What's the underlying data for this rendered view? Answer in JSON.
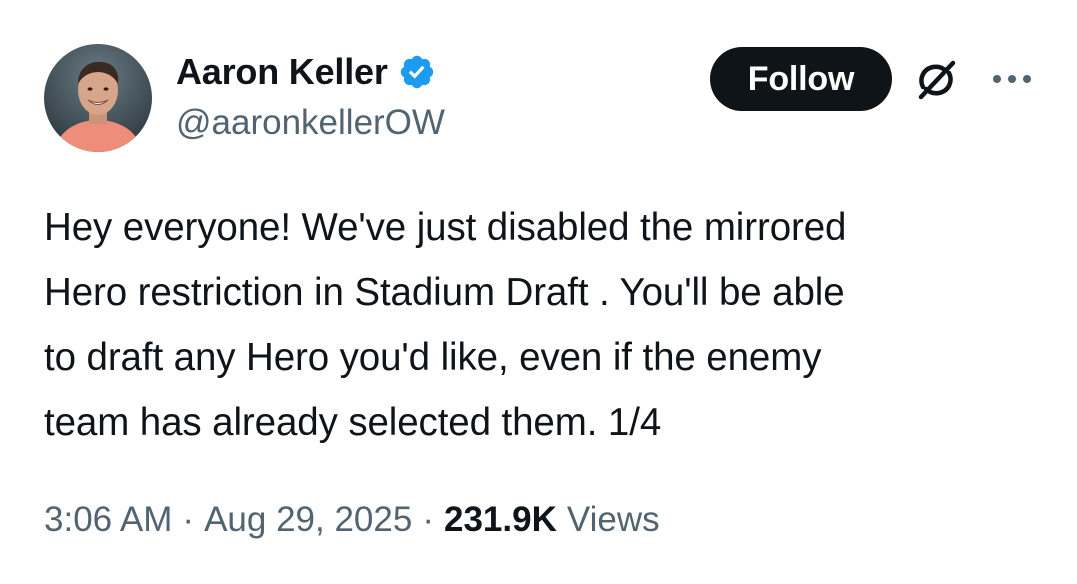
{
  "author": {
    "display_name": "Aaron Keller",
    "handle": "@aaronkellerOW",
    "verified": true,
    "verified_color": "#1d9bf0"
  },
  "actions": {
    "follow_label": "Follow",
    "grok_icon": "grok-icon",
    "more_icon": "more-options-icon"
  },
  "tweet": {
    "text_lines": [
      "Hey everyone! We've just disabled the mirrored",
      "Hero restriction in Stadium Draft . You'll be able",
      "to draft any Hero you'd like, even if the enemy",
      "team has already selected them. 1/4"
    ]
  },
  "meta": {
    "time": "3:06 AM",
    "separator": "·",
    "date": "Aug 29, 2025",
    "views_count": "231.9K",
    "views_label": "Views"
  },
  "colors": {
    "text_primary": "#0f1419",
    "text_secondary": "#536471",
    "button_bg": "#0f1419",
    "button_text": "#ffffff",
    "background": "#ffffff"
  }
}
